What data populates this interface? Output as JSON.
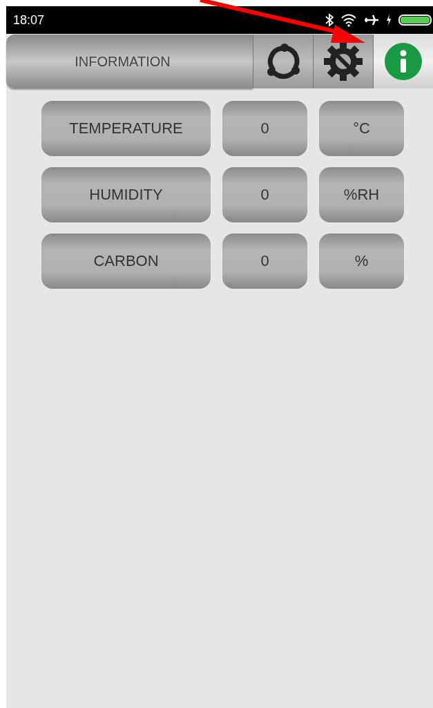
{
  "status_bar": {
    "time": "18:07"
  },
  "header": {
    "title": "INFORMATION",
    "tabs": [
      {
        "kind": "share",
        "selected": false
      },
      {
        "kind": "settings",
        "selected": false
      },
      {
        "kind": "info",
        "selected": true
      }
    ]
  },
  "readings": [
    {
      "name": "TEMPERATURE",
      "value": "0",
      "unit": "°C"
    },
    {
      "name": "HUMIDITY",
      "value": "0",
      "unit": "%RH"
    },
    {
      "name": "CARBON",
      "value": "0",
      "unit": "%"
    }
  ]
}
